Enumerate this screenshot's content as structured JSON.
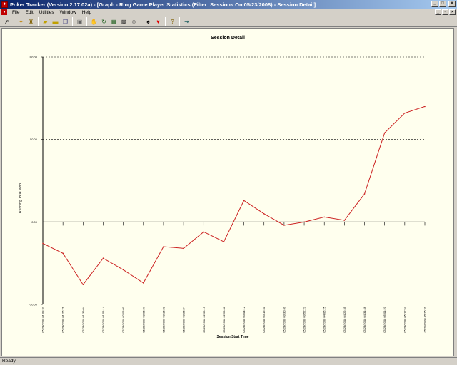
{
  "window": {
    "title": "Poker Tracker (Version 2.17.02a) - [Graph - Ring Game Player Statistics (Filter: Sessions On 05/23/2008) - Session Detail]"
  },
  "menu": {
    "items": [
      "File",
      "Edit",
      "Utilities",
      "Window",
      "Help"
    ]
  },
  "toolbar": {
    "icons": [
      "pointer-icon",
      "open-icon",
      "trophy-icon",
      "folder-open-icon",
      "folder-icon",
      "copy-icon",
      "save-icon",
      "hand-icon",
      "refresh-icon",
      "calendar-icon",
      "grid-icon",
      "player-icon",
      "spade-icon",
      "heart-icon",
      "help-icon",
      "exit-icon"
    ]
  },
  "status": {
    "text": "Ready"
  },
  "colors": {
    "line": "#cc2222",
    "background": "#ffffee",
    "gridline": "#000000"
  },
  "chart_data": {
    "type": "line",
    "title": "Session Detail",
    "xlabel": "Session Start Time",
    "ylabel": "Running Total Won",
    "ylim": [
      -50,
      100
    ],
    "yticks": [
      -50,
      0,
      50,
      100
    ],
    "ytick_labels": [
      "-50.00",
      "0.00",
      "50.00",
      "100.00"
    ],
    "grid": "dashed horizontal at 50 and 100",
    "categories": [
      "05/23/2008 01:09:32",
      "05/23/2008 01:25:26",
      "05/23/2008 01:39:04",
      "05/23/2008 01:51:14",
      "05/23/2008 02:05:00",
      "05/23/2008 02:05:37",
      "05/23/2008 02:15:22",
      "05/23/2008 02:25:24",
      "05/23/2008 02:38:15",
      "05/23/2008 02:50:08",
      "05/23/2008 03:04:12",
      "05/23/2008 03:15:41",
      "05/23/2008 03:30:40",
      "05/23/2008 03:52:23",
      "05/23/2008 04:05:25",
      "05/23/2008 04:22:35",
      "05/23/2008 04:31:46",
      "05/23/2008 05:01:20",
      "05/23/2008 05:12:57",
      "05/23/2008 05:25:11"
    ],
    "values": [
      -13,
      -19,
      -38,
      -22,
      -29,
      -37,
      -15,
      -16,
      -6,
      -12,
      13,
      5,
      -2,
      0,
      3,
      1,
      17,
      54,
      66,
      70
    ]
  }
}
